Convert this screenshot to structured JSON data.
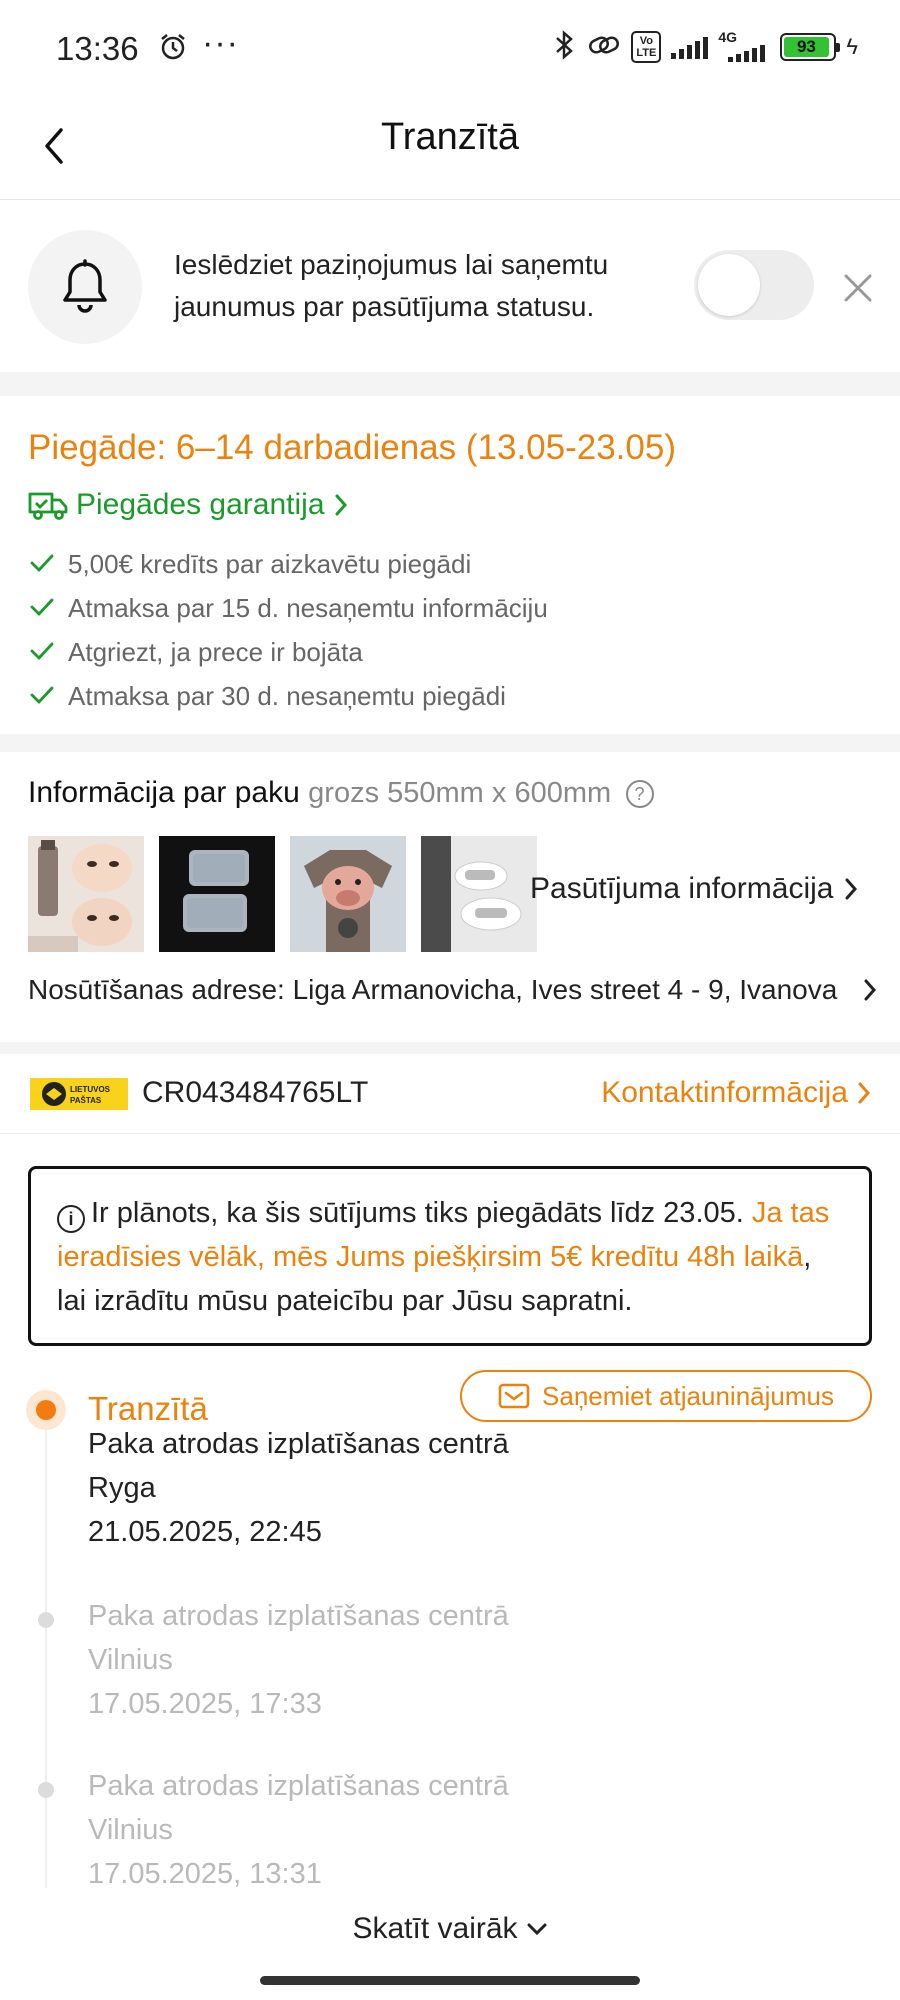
{
  "status_bar": {
    "time": "13:36",
    "dots": "···",
    "volte": "Vo\nLTE",
    "network": "4G",
    "battery": "93"
  },
  "header": {
    "title": "Tranzītā"
  },
  "notification": {
    "text": "Ieslēdziet paziņojumus lai saņemtu jaunumus par pasūtījuma statusu.",
    "toggle_on": false
  },
  "delivery": {
    "title": "Piegāde: 6–14 darbadienas (13.05-23.05)",
    "guarantee_label": "Piegādes garantija",
    "guarantees": [
      "5,00€ kredīts par aizkavētu piegādi",
      "Atmaksa par 15 d. nesaņemtu informāciju",
      "Atgriezt, ja prece ir bojāta",
      "Atmaksa par 30 d. nesaņemtu piegādi"
    ]
  },
  "package": {
    "title": "Informācija par paku",
    "subtitle": "grozs 550mm x 600mm",
    "order_info_label": "Pasūtījuma informācija",
    "address": "Nosūtīšanas adrese: Liga Armanovicha, Ives street 4 - 9, Ivanova"
  },
  "carrier": {
    "logo_text": "LIETUVOS PAŠTAS",
    "tracking_number": "CR043484765LT",
    "contact_label": "Kontaktinformācija"
  },
  "notice": {
    "part1": "Ir plānots, ka šis sūtījums tiks piegādāts līdz 23.05. ",
    "highlight": "Ja tas ieradīsies vēlāk, mēs Jums piešķirsim 5€ kredītu 48h laikā",
    "part2": ", lai izrādītu mūsu pateicību par Jūsu sapratni."
  },
  "timeline": {
    "current_status": "Tranzītā",
    "updates_button": "Saņemiet atjauninājumus",
    "events": [
      {
        "description": "Paka atrodas izplatīšanas centrā",
        "location": "Ryga",
        "datetime": "21.05.2025, 22:45"
      },
      {
        "description": "Paka atrodas izplatīšanas centrā",
        "location": "Vilnius",
        "datetime": "17.05.2025, 17:33"
      },
      {
        "description": "Paka atrodas izplatīšanas centrā",
        "location": "Vilnius",
        "datetime": "17.05.2025, 13:31"
      }
    ]
  },
  "show_more_label": "Skatīt vairāk",
  "colors": {
    "accent_orange": "#e8830f",
    "guarantee_green": "#1b9a2b"
  }
}
